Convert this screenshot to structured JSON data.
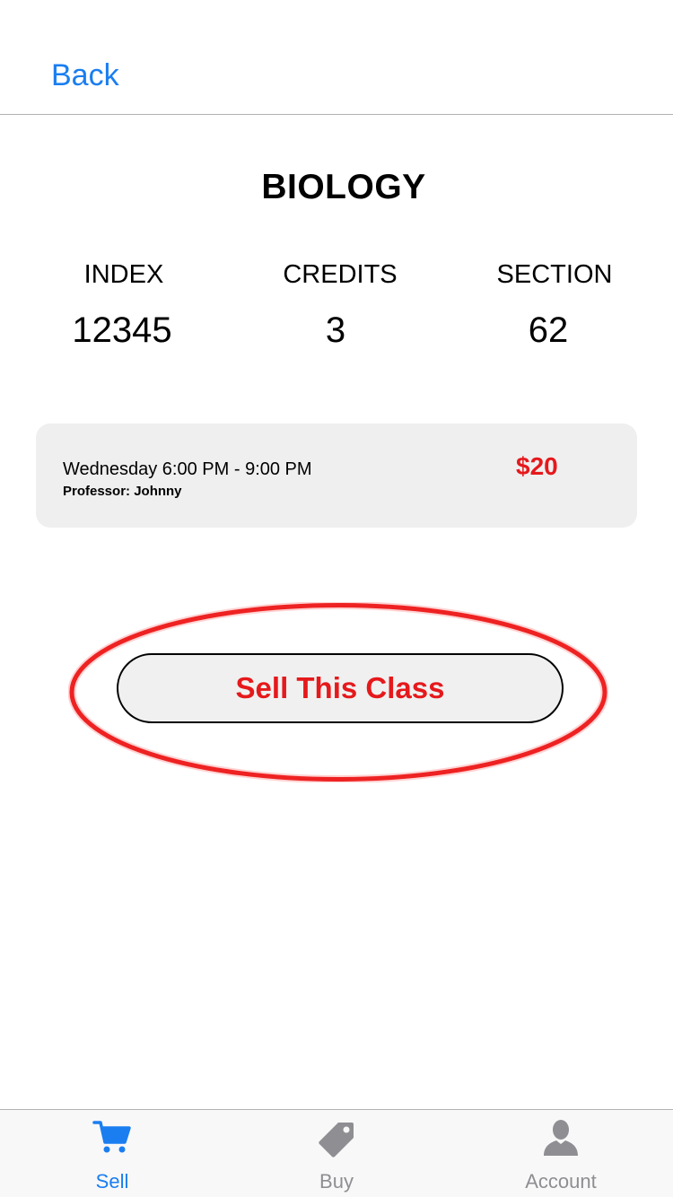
{
  "nav": {
    "back_label": "Back"
  },
  "course": {
    "title": "BIOLOGY",
    "stats": [
      {
        "label": "INDEX",
        "value": "12345"
      },
      {
        "label": "CREDITS",
        "value": "3"
      },
      {
        "label": "SECTION",
        "value": "62"
      }
    ]
  },
  "schedule": {
    "time": "Wednesday 6:00 PM - 9:00 PM",
    "professor": "Professor: Johnny",
    "price": "$20"
  },
  "actions": {
    "sell_label": "Sell This Class"
  },
  "tabs": [
    {
      "label": "Sell",
      "icon": "cart-icon",
      "active": true
    },
    {
      "label": "Buy",
      "icon": "tag-icon",
      "active": false
    },
    {
      "label": "Account",
      "icon": "person-icon",
      "active": false
    }
  ],
  "colors": {
    "accent": "#1a7ef0",
    "price_red": "#e5191c",
    "inactive_gray": "#8e8e93",
    "card_bg": "#efefef",
    "annotation_red": "#e60000"
  }
}
